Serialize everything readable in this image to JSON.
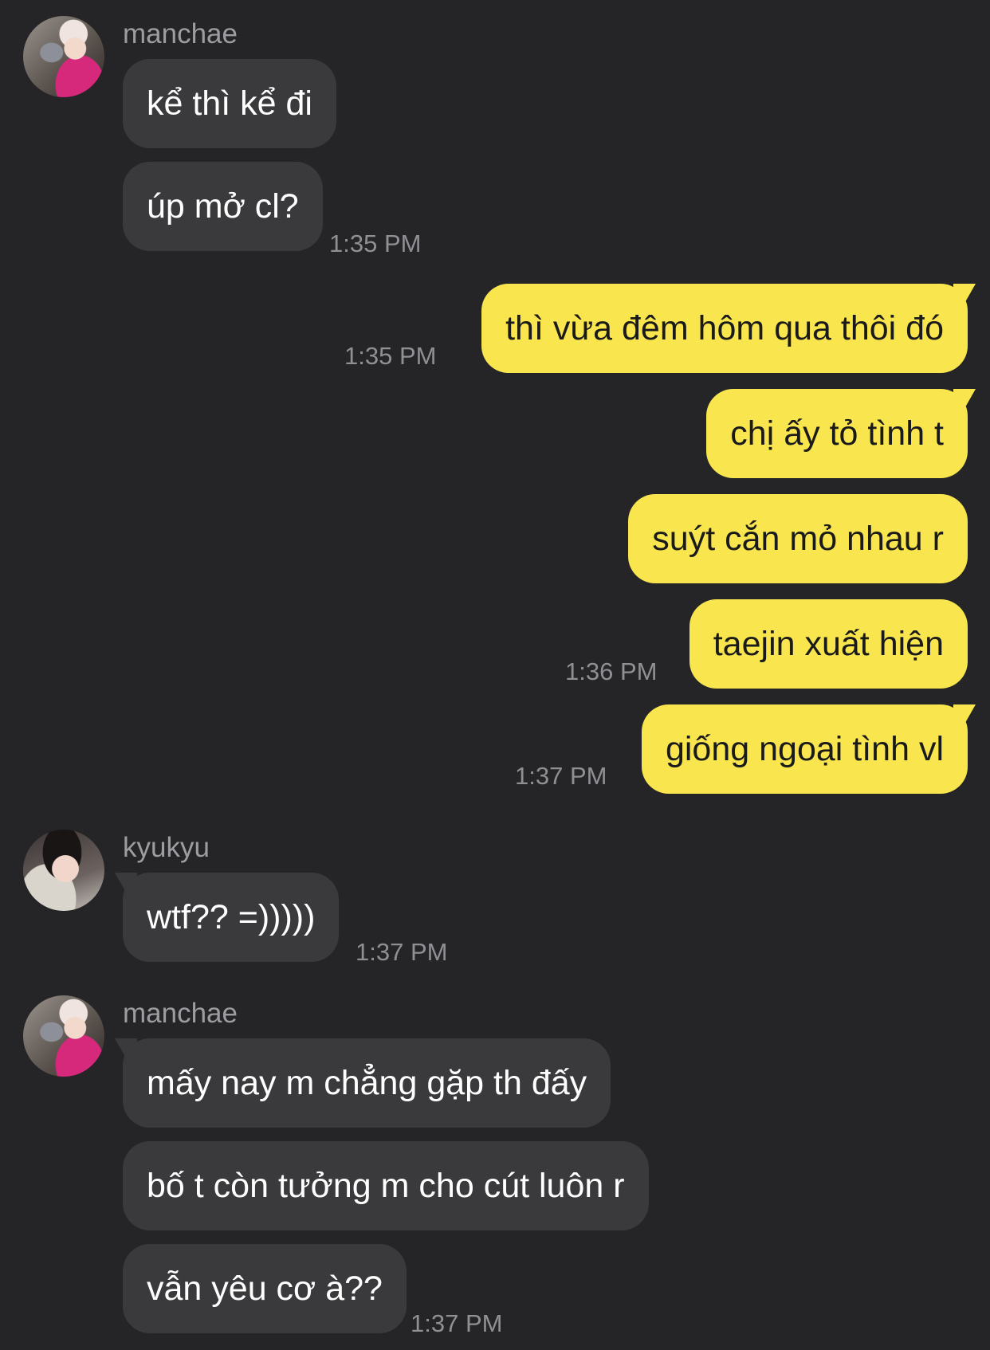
{
  "messages": [
    {
      "sender": "manchae",
      "text": "kể thì kể đi"
    },
    {
      "sender": "manchae",
      "text": "úp mở cl?",
      "time": "1:35 PM"
    },
    {
      "sender": "me",
      "text": "thì vừa đêm hôm qua thôi đó",
      "time": "1:35 PM"
    },
    {
      "sender": "me",
      "text": "chị ấy tỏ tình t"
    },
    {
      "sender": "me",
      "text": "suýt cắn mỏ nhau r"
    },
    {
      "sender": "me",
      "text": "taejin xuất hiện",
      "time": "1:36 PM"
    },
    {
      "sender": "me",
      "text": "giống ngoại tình vl",
      "time": "1:37 PM"
    },
    {
      "sender": "kyukyu",
      "text": "wtf?? =)))))",
      "time": "1:37 PM"
    },
    {
      "sender": "manchae",
      "text": "mấy nay m chẳng gặp th đấy"
    },
    {
      "sender": "manchae",
      "text": "bố t còn tưởng m cho cút luôn r"
    },
    {
      "sender": "manchae",
      "text": "vẫn yêu cơ à??",
      "time": "1:37 PM"
    }
  ],
  "groups": [
    {
      "name": "manchae"
    },
    {
      "name": "kyukyu"
    },
    {
      "name": "manchae"
    }
  ],
  "colors": {
    "background": "#252527",
    "incoming_bubble": "#3a3a3c",
    "outgoing_bubble": "#f9e54e",
    "timestamp": "#8f8f94"
  }
}
